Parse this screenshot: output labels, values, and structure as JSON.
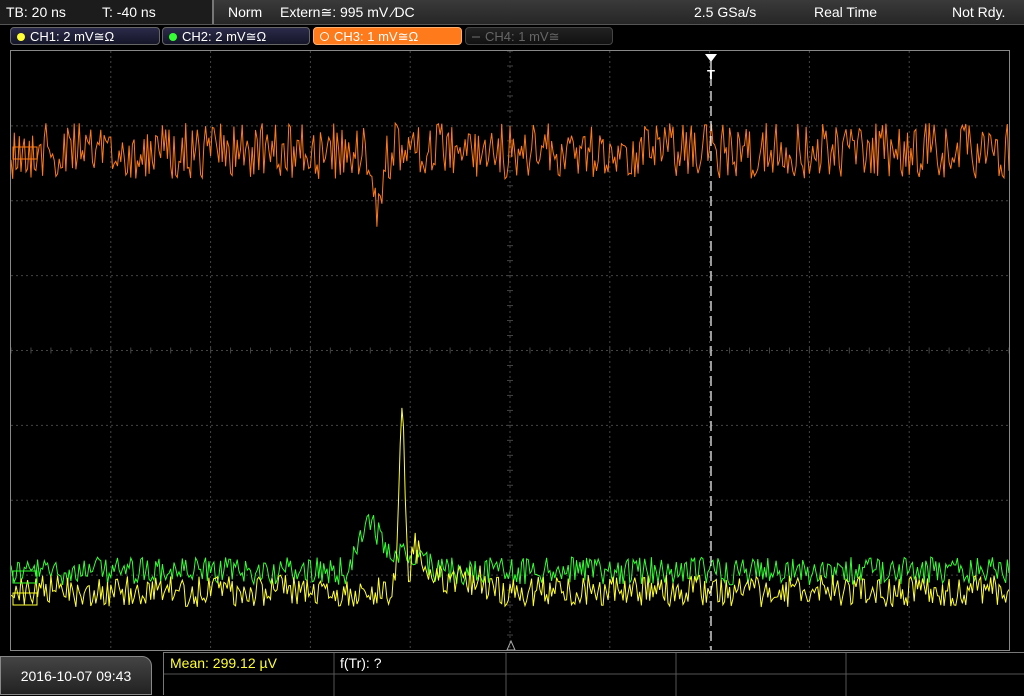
{
  "topbar": {
    "timebase": "TB: 20 ns",
    "trigger_offset": "T: -40 ns",
    "mode": "Norm",
    "trigger_source": "Extern≅: 995 mV ⁄DC",
    "sample_rate": "2.5 GSa/s",
    "acq_mode": "Real Time",
    "status": "Not Rdy."
  },
  "channels": [
    {
      "label": "CH1: 2 mV≅Ω",
      "color": "#ffff33",
      "state": "on"
    },
    {
      "label": "CH2: 2 mV≅Ω",
      "color": "#33ff33",
      "state": "on"
    },
    {
      "label": "CH3: 1 mV≅Ω",
      "color": "#ff7a1a",
      "state": "active"
    },
    {
      "label": "CH4: 1 mV≅",
      "color": "#666666",
      "state": "off"
    }
  ],
  "trigger_marker": "T",
  "footer": {
    "datetime": "2016-10-07 09:43",
    "mean_label": "Mean: 299.12 µV",
    "ftr_label": "f(Tr): ?"
  },
  "colors": {
    "ch1": "#ffff33",
    "ch2": "#33ff33",
    "ch3": "#ff7a1a",
    "grid": "#444444"
  }
}
